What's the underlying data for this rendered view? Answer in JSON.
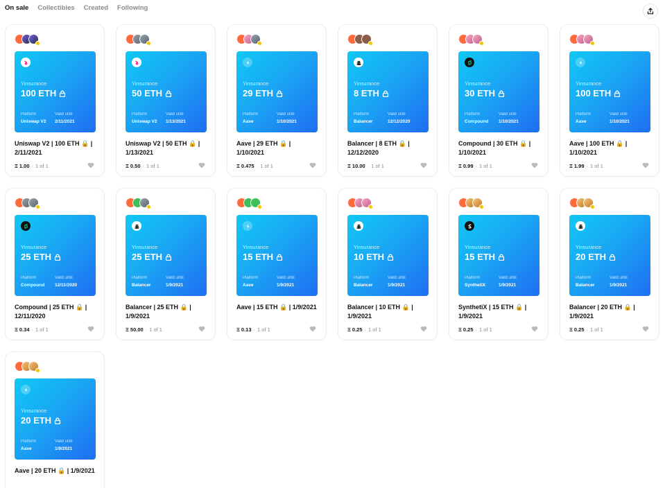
{
  "tabs": [
    "On sale",
    "Collectibles",
    "Created",
    "Following"
  ],
  "brand": "Yinsurance",
  "labels": {
    "platform": "Platform",
    "valid": "Valid until",
    "edition": "1 of 1",
    "dot": "·"
  },
  "colors": {
    "accent_start": "#11c8f5",
    "accent_end": "#1f6ef2",
    "creator": "#ff6a3d",
    "verified": "#f4c400"
  },
  "cards": [
    {
      "amount": "100 ETH",
      "platform": "Uniswap V2",
      "valid": "2/11/2021",
      "title": "Uniswap V2 | 100 ETH 🔒 | 2/11/2021",
      "price": "Ξ 1.00",
      "logo": "uniswap-icon",
      "avatars": [
        "orange",
        "purple",
        "purple"
      ]
    },
    {
      "amount": "50 ETH",
      "platform": "Uniswap V2",
      "valid": "1/13/2021",
      "title": "Uniswap V2 | 50 ETH 🔒 | 1/13/2021",
      "price": "Ξ 0.50",
      "logo": "uniswap-icon",
      "avatars": [
        "orange",
        "gray",
        "gray"
      ]
    },
    {
      "amount": "29 ETH",
      "platform": "Aave",
      "valid": "1/10/2021",
      "title": "Aave | 29 ETH 🔒 | 1/10/2021",
      "price": "Ξ 0.475",
      "logo": "aave-icon",
      "avatars": [
        "orange",
        "pink",
        "gray"
      ]
    },
    {
      "amount": "8 ETH",
      "platform": "Balancer",
      "valid": "12/12/2020",
      "title": "Balancer | 8 ETH 🔒 | 12/12/2020",
      "price": "Ξ 10.00",
      "logo": "balancer-icon",
      "avatars": [
        "orange",
        "brown",
        "brown"
      ]
    },
    {
      "amount": "30 ETH",
      "platform": "Compound",
      "valid": "1/10/2021",
      "title": "Compound | 30 ETH 🔒 | 1/10/2021",
      "price": "Ξ 0.99",
      "logo": "compound-icon",
      "avatars": [
        "orange",
        "pink",
        "pink"
      ]
    },
    {
      "amount": "100 ETH",
      "platform": "Aave",
      "valid": "1/10/2021",
      "title": "Aave | 100 ETH 🔒 | 1/10/2021",
      "price": "Ξ 1.99",
      "logo": "aave-icon",
      "avatars": [
        "orange",
        "pink",
        "pink"
      ]
    },
    {
      "amount": "25 ETH",
      "platform": "Compound",
      "valid": "12/11/2020",
      "title": "Compound | 25 ETH 🔒 | 12/11/2020",
      "price": "Ξ 0.34",
      "logo": "compound-icon",
      "avatars": [
        "orange",
        "gray",
        "gray"
      ]
    },
    {
      "amount": "25 ETH",
      "platform": "Balancer",
      "valid": "1/9/2021",
      "title": "Balancer | 25 ETH 🔒 | 1/9/2021",
      "price": "Ξ 50.00",
      "logo": "balancer-icon",
      "avatars": [
        "orange",
        "green",
        "gray"
      ]
    },
    {
      "amount": "15 ETH",
      "platform": "Aave",
      "valid": "1/9/2021",
      "title": "Aave | 15 ETH 🔒 | 1/9/2021",
      "price": "Ξ 0.13",
      "logo": "aave-icon",
      "avatars": [
        "orange",
        "green",
        "green"
      ]
    },
    {
      "amount": "10 ETH",
      "platform": "Balancer",
      "valid": "1/9/2021",
      "title": "Balancer | 10 ETH 🔒 | 1/9/2021",
      "price": "Ξ 0.25",
      "logo": "balancer-icon",
      "avatars": [
        "orange",
        "pink",
        "pink"
      ]
    },
    {
      "amount": "15 ETH",
      "platform": "SynthetiX",
      "valid": "1/9/2021",
      "title": "SynthetiX | 15 ETH 🔒 | 1/9/2021",
      "price": "Ξ 0.25",
      "logo": "synthetix-icon",
      "avatars": [
        "orange",
        "cat",
        "cat"
      ]
    },
    {
      "amount": "20 ETH",
      "platform": "Balancer",
      "valid": "1/9/2021",
      "title": "Balancer | 20 ETH 🔒 | 1/9/2021",
      "price": "Ξ 0.25",
      "logo": "balancer-icon",
      "avatars": [
        "orange",
        "cat",
        "cat"
      ]
    },
    {
      "amount": "20 ETH",
      "platform": "Aave",
      "valid": "1/9/2021",
      "title": "Aave | 20 ETH 🔒 | 1/9/2021",
      "price": "",
      "logo": "aave-icon",
      "avatars": [
        "orange",
        "cat",
        "cat"
      ]
    }
  ]
}
